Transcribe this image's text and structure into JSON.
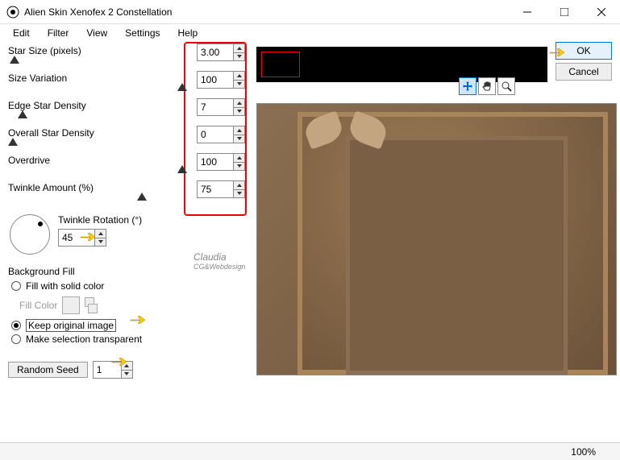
{
  "window": {
    "title": "Alien Skin Xenofex 2 Constellation"
  },
  "menu": {
    "edit": "Edit",
    "filter": "Filter",
    "view": "View",
    "settings": "Settings",
    "help": "Help"
  },
  "params": {
    "star_size": {
      "label": "Star Size (pixels)",
      "value": "3.00"
    },
    "size_variation": {
      "label": "Size Variation",
      "value": "100"
    },
    "edge_density": {
      "label": "Edge Star Density",
      "value": "7"
    },
    "overall_density": {
      "label": "Overall Star Density",
      "value": "0"
    },
    "overdrive": {
      "label": "Overdrive",
      "value": "100"
    },
    "twinkle_amount": {
      "label": "Twinkle Amount (%)",
      "value": "75"
    },
    "twinkle_rotation": {
      "label": "Twinkle Rotation (°)",
      "value": "45"
    }
  },
  "bg_fill": {
    "title": "Background Fill",
    "fill_solid": "Fill with solid color",
    "fill_color": "Fill Color",
    "keep_original": "Keep original image",
    "make_transparent": "Make selection transparent"
  },
  "random_seed": {
    "button": "Random Seed",
    "value": "1"
  },
  "buttons": {
    "ok": "OK",
    "cancel": "Cancel"
  },
  "status": {
    "zoom": "100%"
  },
  "watermark": {
    "text": "Claudia",
    "sub": "CG&Webdesign"
  }
}
